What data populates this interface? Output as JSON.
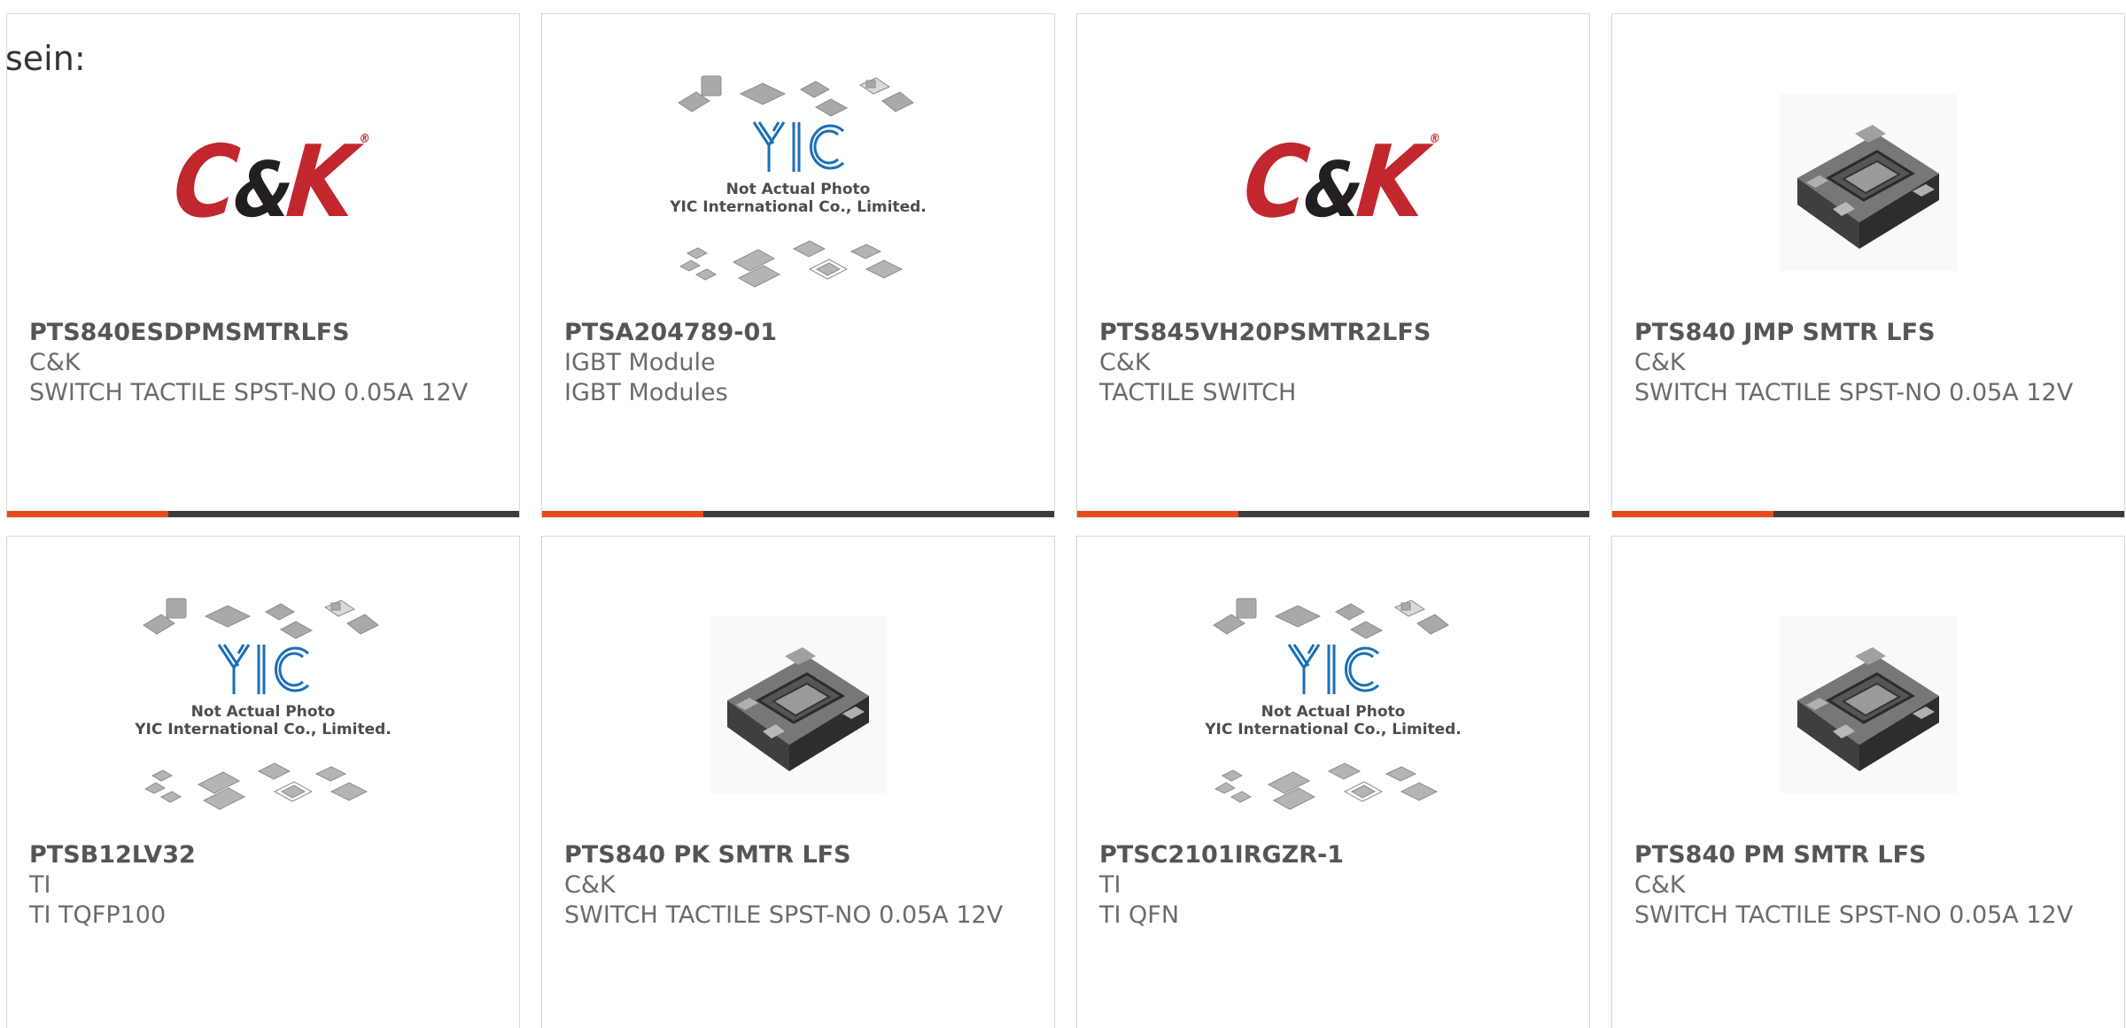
{
  "intro_text": "sein:",
  "colors": {
    "accent": "#e84a1c",
    "bar": "#3b3b3b",
    "brand_red": "#c1272d",
    "yic_blue": "#1b6fb5"
  },
  "products": [
    {
      "part_number": "PTS840ESDPMSMTRLFS",
      "manufacturer": "C&K",
      "description": "SWITCH TACTILE SPST-NO 0.05A 12V",
      "image": "ck-logo"
    },
    {
      "part_number": "PTSA204789-01",
      "manufacturer": "IGBT Module",
      "description": "IGBT Modules",
      "image": "yic-placeholder"
    },
    {
      "part_number": "PTS845VH20PSMTR2LFS",
      "manufacturer": "C&K",
      "description": "TACTILE SWITCH",
      "image": "ck-logo"
    },
    {
      "part_number": "PTS840 JMP SMTR LFS",
      "manufacturer": "C&K",
      "description": "SWITCH TACTILE SPST-NO 0.05A 12V",
      "image": "tactile-switch-photo"
    },
    {
      "part_number": "PTSB12LV32",
      "manufacturer": "TI",
      "description": "TI TQFP100",
      "image": "yic-placeholder"
    },
    {
      "part_number": "PTS840 PK SMTR LFS",
      "manufacturer": "C&K",
      "description": "SWITCH TACTILE SPST-NO 0.05A 12V",
      "image": "tactile-switch-photo"
    },
    {
      "part_number": "PTSC2101IRGZR-1",
      "manufacturer": "TI",
      "description": "TI QFN",
      "image": "yic-placeholder"
    },
    {
      "part_number": "PTS840 PM SMTR LFS",
      "manufacturer": "C&K",
      "description": "SWITCH TACTILE SPST-NO 0.05A 12V",
      "image": "tactile-switch-photo"
    }
  ],
  "placeholder": {
    "brand": "YIC",
    "line1": "Not Actual Photo",
    "line2": "YIC International Co., Limited."
  },
  "ck_logo": {
    "left": "C",
    "amp": "&",
    "right": "K",
    "reg": "®"
  }
}
